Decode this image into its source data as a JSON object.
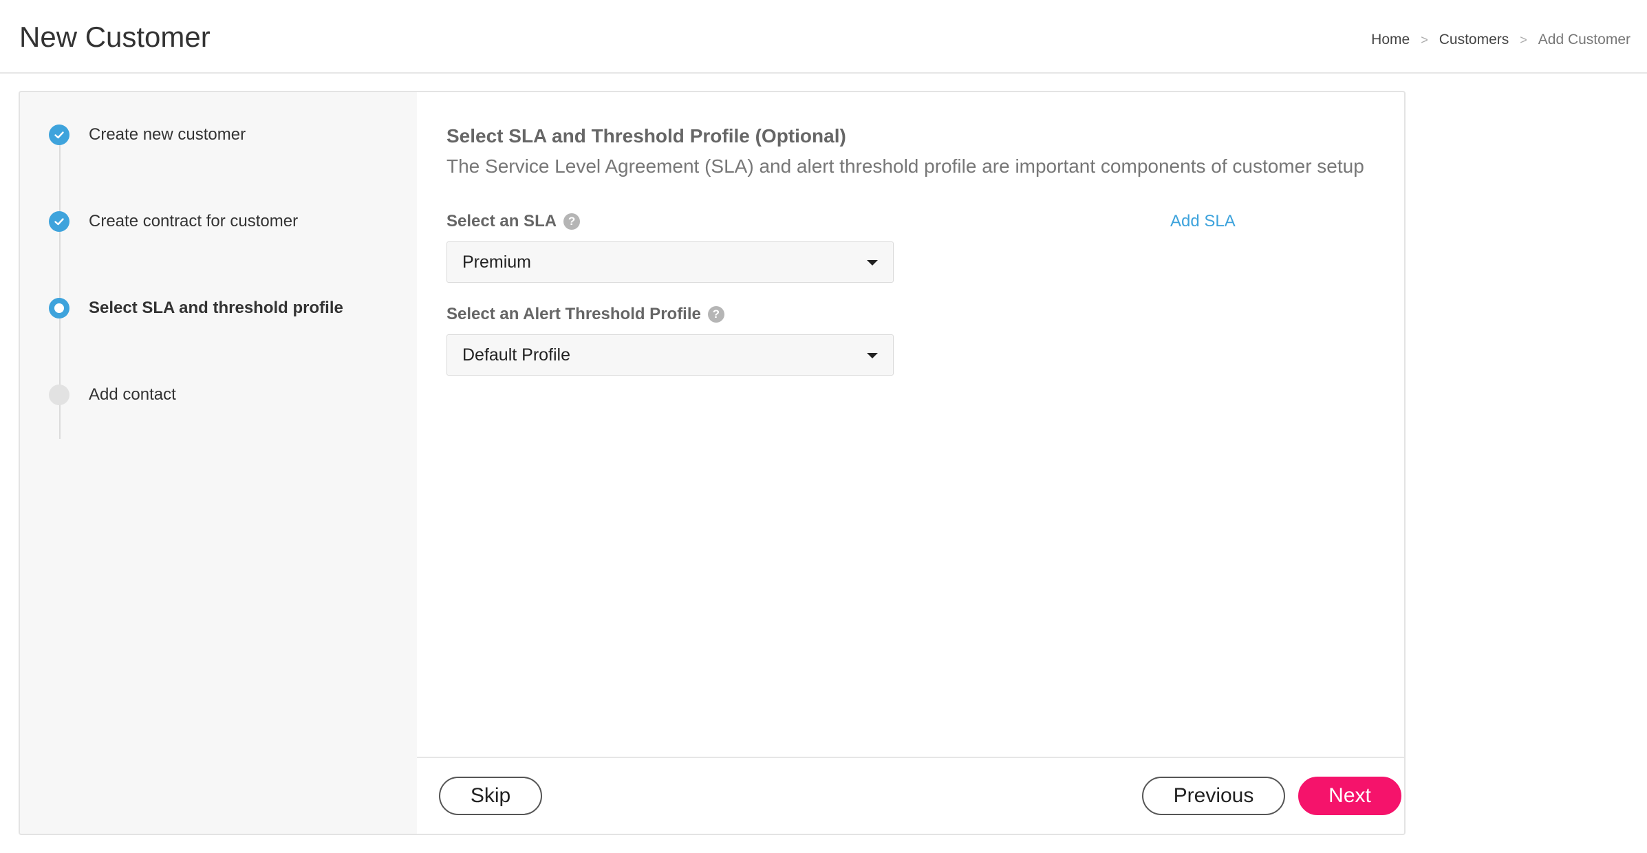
{
  "header": {
    "title": "New Customer",
    "breadcrumb": {
      "home": "Home",
      "customers": "Customers",
      "current": "Add Customer",
      "separator": ">"
    }
  },
  "steps": [
    {
      "label": "Create new customer",
      "status": "done"
    },
    {
      "label": "Create contract for customer",
      "status": "done"
    },
    {
      "label": "Select SLA and threshold profile",
      "status": "current"
    },
    {
      "label": "Add contact",
      "status": "todo"
    }
  ],
  "section": {
    "title": "Select SLA and Threshold Profile (Optional)",
    "description": "The Service Level Agreement (SLA) and alert threshold profile are important components of customer setup"
  },
  "sla": {
    "label": "Select an SLA",
    "add_link": "Add SLA",
    "selected": "Premium"
  },
  "threshold": {
    "label": "Select an Alert Threshold Profile",
    "selected": "Default Profile"
  },
  "footer": {
    "skip": "Skip",
    "previous": "Previous",
    "next": "Next"
  },
  "colors": {
    "accent": "#3ea3dc",
    "primary_button": "#f5136b"
  },
  "icons": {
    "help": "?",
    "check": "check-icon"
  }
}
